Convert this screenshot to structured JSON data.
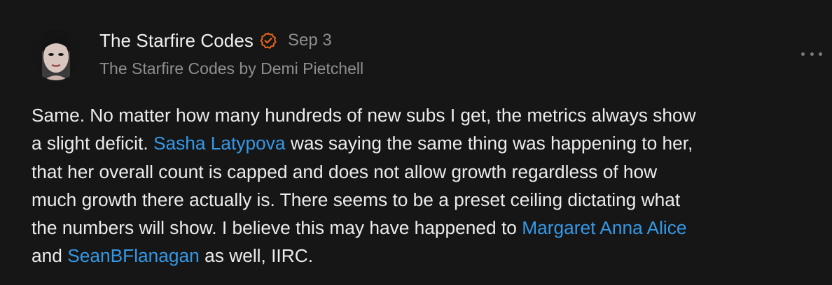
{
  "comment": {
    "author": {
      "name": "The Starfire Codes",
      "verified_icon": "verified-check-icon",
      "byline": "The Starfire Codes by Demi Pietchell"
    },
    "timestamp": "Sep 3",
    "more_icon": "more-horizontal-icon",
    "body": {
      "line1": "Same. No matter how many hundreds of new subs I get, the metrics always show",
      "line2_pre": "a slight deficit. ",
      "mention1": "Sasha Latypova",
      "line2_post": " was saying the same thing was happening to her,",
      "line3": "that her overall count is capped and does not allow growth regardless of how",
      "line4": "much growth there actually is. There seems to be a preset ceiling dictating what",
      "line5_pre": "the numbers will show. I believe this may have happened to ",
      "mention2": "Margaret Anna Alice",
      "line6_pre": "and ",
      "mention3": "SeanBFlanagan",
      "line6_post": " as well, IIRC."
    }
  },
  "colors": {
    "background": "#161616",
    "text": "#ececec",
    "muted": "#8e8e8e",
    "link": "#3598e6",
    "verified": "#e8641e"
  }
}
